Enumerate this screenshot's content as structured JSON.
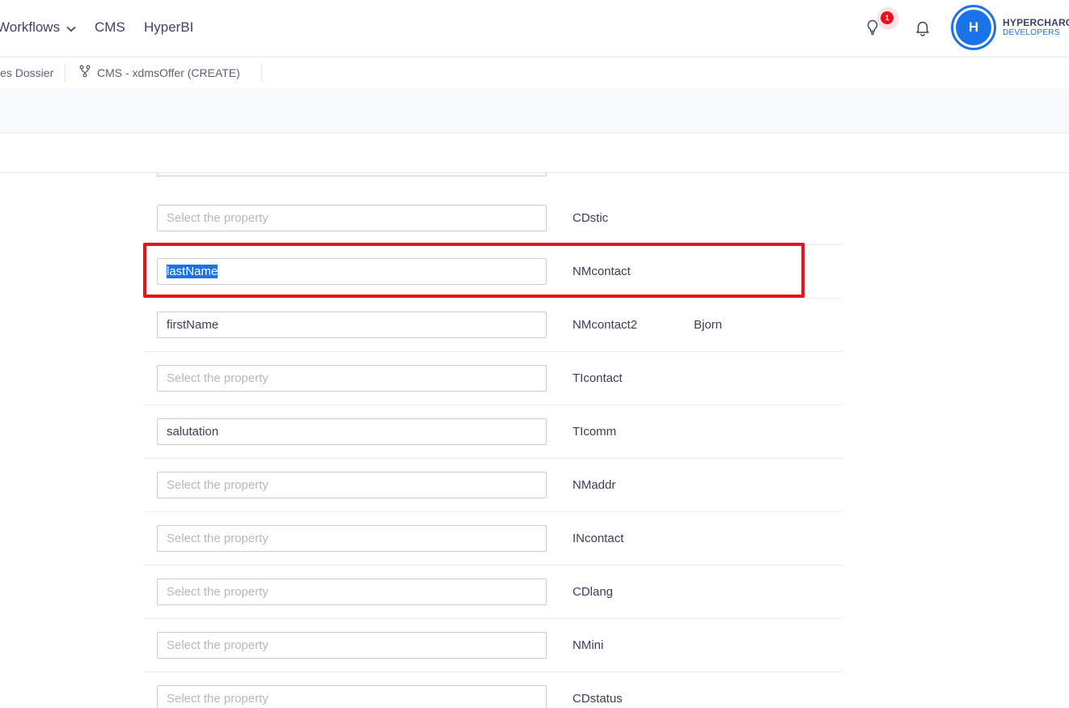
{
  "nav": {
    "items": [
      "Workflows",
      "CMS",
      "HyperBI"
    ],
    "notification_count": "1",
    "avatar_initial": "H",
    "org_name": "HYPERCHARGE",
    "org_sub": "DEVELOPERS"
  },
  "tabs": [
    {
      "label": "les Dossier"
    },
    {
      "label": "CMS - xdmsOffer (CREATE)"
    }
  ],
  "mapping": {
    "placeholder": "Select the property",
    "rows": [
      {
        "value": "",
        "field": "CDstic",
        "sample": ""
      },
      {
        "value": "lastName",
        "field": "NMcontact",
        "sample": "",
        "selected": true
      },
      {
        "value": "firstName",
        "field": "NMcontact2",
        "sample": "Bjorn"
      },
      {
        "value": "",
        "field": "TIcontact",
        "sample": ""
      },
      {
        "value": "salutation",
        "field": "TIcomm",
        "sample": ""
      },
      {
        "value": "",
        "field": "NMaddr",
        "sample": ""
      },
      {
        "value": "",
        "field": "INcontact",
        "sample": ""
      },
      {
        "value": "",
        "field": "CDlang",
        "sample": ""
      },
      {
        "value": "",
        "field": "NMini",
        "sample": ""
      },
      {
        "value": "",
        "field": "CDstatus",
        "sample": ""
      }
    ]
  },
  "colors": {
    "accent": "#1a73e8",
    "highlight": "#e8131b",
    "badge": "#e8111b"
  }
}
